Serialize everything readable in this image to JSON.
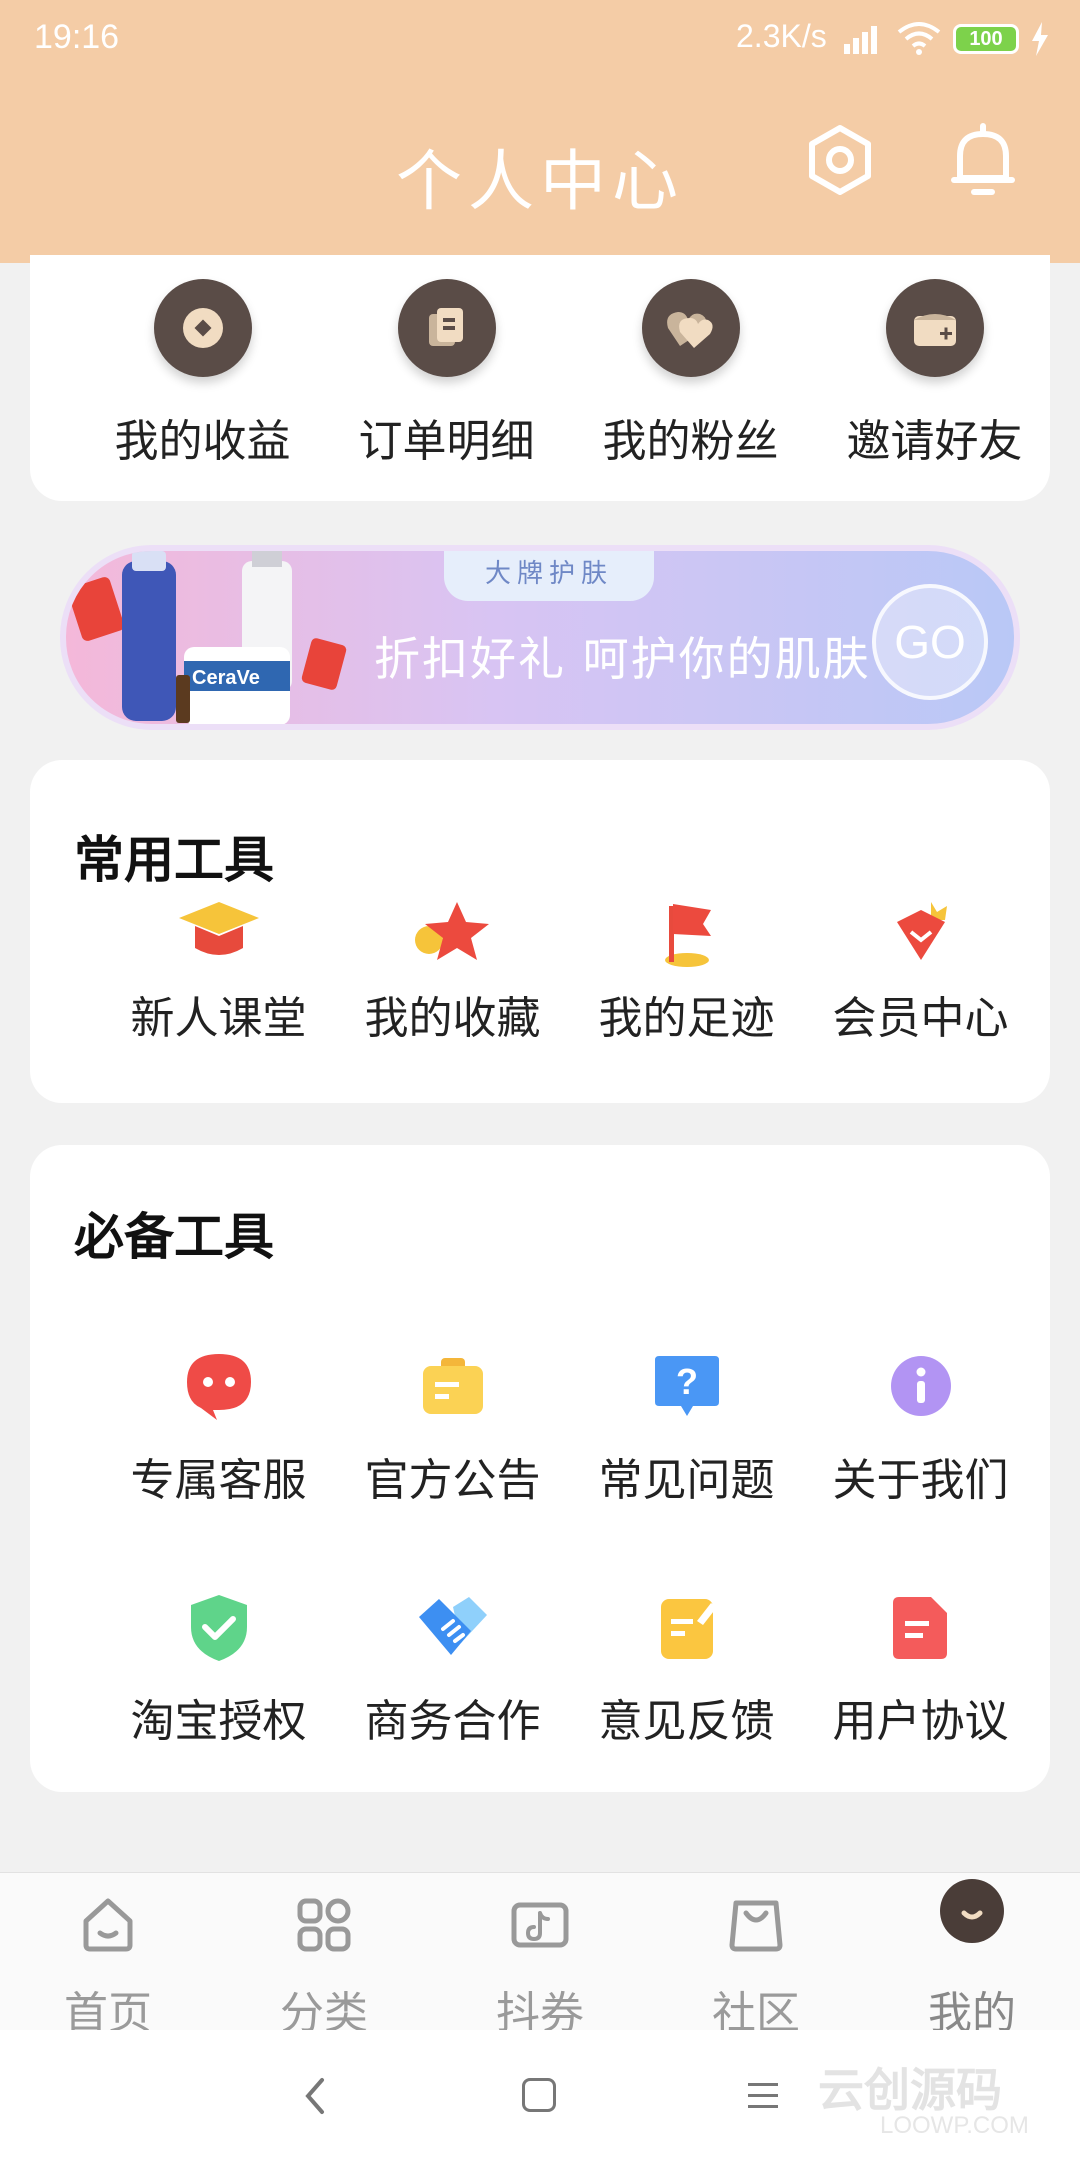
{
  "status_bar": {
    "time": "19:16",
    "net_speed": "2.3K/s",
    "battery": "100"
  },
  "header": {
    "title": "个人中心",
    "settings_icon": "settings-icon",
    "notification_icon": "bell-icon"
  },
  "top_menu": [
    {
      "label": "我的收益",
      "icon": "coin-icon"
    },
    {
      "label": "订单明细",
      "icon": "order-icon"
    },
    {
      "label": "我的粉丝",
      "icon": "fans-icon"
    },
    {
      "label": "邀请好友",
      "icon": "invite-icon"
    }
  ],
  "banner": {
    "tag": "大牌护肤",
    "slogan": "折扣好礼 呵护你的肌肤",
    "cta": "GO",
    "product_brand": "CeraVe"
  },
  "common_tools": {
    "title": "常用工具",
    "items": [
      {
        "label": "新人课堂",
        "icon": "graduation-cap-icon"
      },
      {
        "label": "我的收藏",
        "icon": "star-icon"
      },
      {
        "label": "我的足迹",
        "icon": "flag-icon"
      },
      {
        "label": "会员中心",
        "icon": "crown-icon"
      }
    ]
  },
  "essential_tools": {
    "title": "必备工具",
    "items": [
      {
        "label": "专属客服",
        "icon": "chat-bubble-icon"
      },
      {
        "label": "官方公告",
        "icon": "announcement-icon"
      },
      {
        "label": "常见问题",
        "icon": "question-icon"
      },
      {
        "label": "关于我们",
        "icon": "info-icon"
      },
      {
        "label": "淘宝授权",
        "icon": "shield-check-icon"
      },
      {
        "label": "商务合作",
        "icon": "handshake-icon"
      },
      {
        "label": "意见反馈",
        "icon": "feedback-icon"
      },
      {
        "label": "用户协议",
        "icon": "document-icon"
      }
    ]
  },
  "tab_bar": [
    {
      "label": "首页",
      "icon": "home-icon"
    },
    {
      "label": "分类",
      "icon": "category-icon"
    },
    {
      "label": "抖券",
      "icon": "douyin-coupon-icon"
    },
    {
      "label": "社区",
      "icon": "community-bag-icon"
    },
    {
      "label": "我的",
      "icon": "profile-avatar-icon",
      "active": true
    }
  ],
  "watermark": {
    "text": "云创源码",
    "sub": "LOOWP.COM"
  },
  "colors": {
    "header_bg": "#f4cca6",
    "page_bg": "#f1f1f1",
    "icon_dark": "#5a4c47"
  }
}
